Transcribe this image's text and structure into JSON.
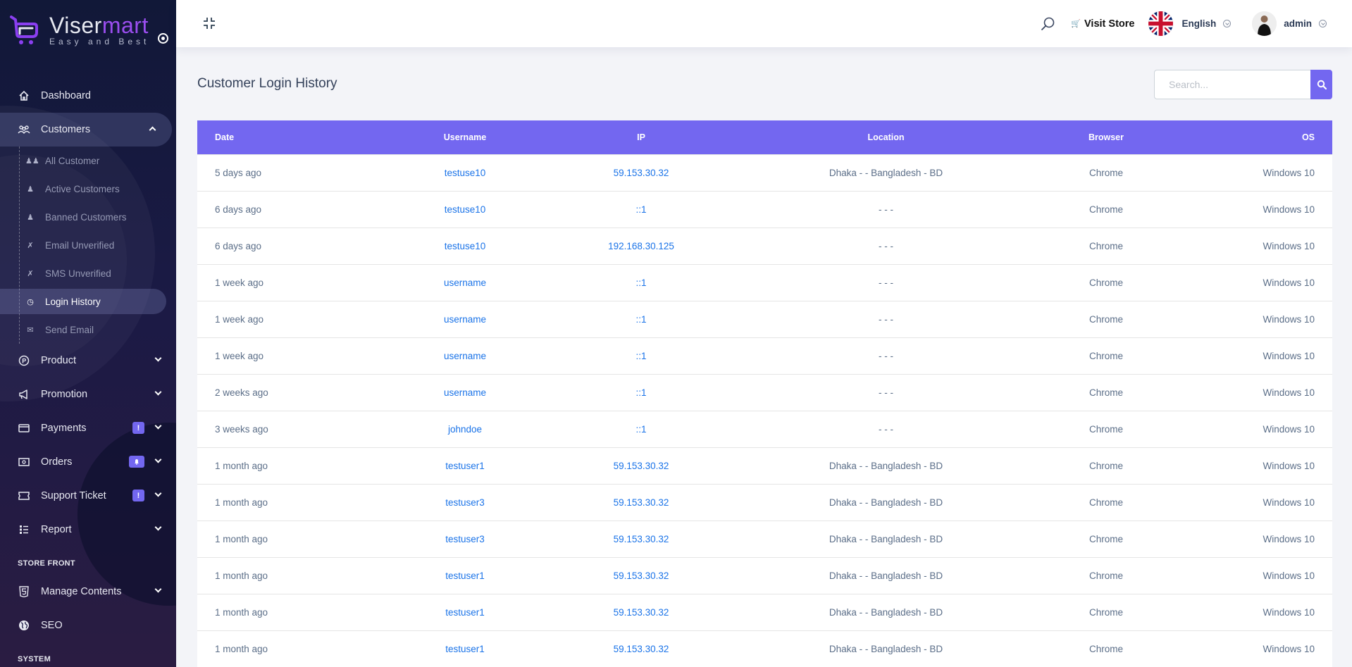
{
  "brand": {
    "name_part1": "Viser",
    "name_part2": "mart",
    "tagline": "Easy and Best"
  },
  "sidebar": {
    "items_top": [
      {
        "label": "Dashboard",
        "icon": "home-icon"
      }
    ],
    "customers": {
      "label": "Customers",
      "icon": "users-icon",
      "subitems": [
        {
          "label": "All Customer",
          "icon": "users-icon"
        },
        {
          "label": "Active Customers",
          "icon": "user-check-icon"
        },
        {
          "label": "Banned Customers",
          "icon": "user-ban-icon"
        },
        {
          "label": "Email Unverified",
          "icon": "user-slash-icon"
        },
        {
          "label": "SMS Unverified",
          "icon": "user-slash-icon"
        },
        {
          "label": "Login History",
          "icon": "history-icon",
          "active": true
        },
        {
          "label": "Send Email",
          "icon": "envelope-icon"
        }
      ]
    },
    "items_main": [
      {
        "label": "Product",
        "icon": "product-icon",
        "badge": ""
      },
      {
        "label": "Promotion",
        "icon": "megaphone-icon",
        "badge": "!"
      },
      {
        "label": "Payments",
        "icon": "credit-card-icon",
        "badge": "!"
      },
      {
        "label": "Orders",
        "icon": "money-icon",
        "badge": "bell"
      },
      {
        "label": "Support Ticket",
        "icon": "ticket-icon",
        "badge": "!"
      },
      {
        "label": "Report",
        "icon": "list-icon",
        "badge": ""
      }
    ],
    "section_store_front": "STORE FRONT",
    "items_store": [
      {
        "label": "Manage Contents",
        "icon": "html5-icon"
      },
      {
        "label": "SEO",
        "icon": "globe-icon"
      }
    ],
    "section_system": "SYSTEM"
  },
  "topbar": {
    "visit_store": "Visit Store",
    "language": "English",
    "user": "admin"
  },
  "page": {
    "title": "Customer Login History",
    "search_placeholder": "Search...",
    "accent": "#7367f0"
  },
  "table": {
    "headers": [
      "Date",
      "Username",
      "IP",
      "Location",
      "Browser",
      "OS"
    ],
    "rows": [
      [
        "5 days ago",
        "testuse10",
        "59.153.30.32",
        "Dhaka - - Bangladesh - BD",
        "Chrome",
        "Windows 10"
      ],
      [
        "6 days ago",
        "testuse10",
        "::1",
        "- - -",
        "Chrome",
        "Windows 10"
      ],
      [
        "6 days ago",
        "testuse10",
        "192.168.30.125",
        "- - -",
        "Chrome",
        "Windows 10"
      ],
      [
        "1 week ago",
        "username",
        "::1",
        "- - -",
        "Chrome",
        "Windows 10"
      ],
      [
        "1 week ago",
        "username",
        "::1",
        "- - -",
        "Chrome",
        "Windows 10"
      ],
      [
        "1 week ago",
        "username",
        "::1",
        "- - -",
        "Chrome",
        "Windows 10"
      ],
      [
        "2 weeks ago",
        "username",
        "::1",
        "- - -",
        "Chrome",
        "Windows 10"
      ],
      [
        "3 weeks ago",
        "johndoe",
        "::1",
        "- - -",
        "Chrome",
        "Windows 10"
      ],
      [
        "1 month ago",
        "testuser1",
        "59.153.30.32",
        "Dhaka - - Bangladesh - BD",
        "Chrome",
        "Windows 10"
      ],
      [
        "1 month ago",
        "testuser3",
        "59.153.30.32",
        "Dhaka - - Bangladesh - BD",
        "Chrome",
        "Windows 10"
      ],
      [
        "1 month ago",
        "testuser3",
        "59.153.30.32",
        "Dhaka - - Bangladesh - BD",
        "Chrome",
        "Windows 10"
      ],
      [
        "1 month ago",
        "testuser1",
        "59.153.30.32",
        "Dhaka - - Bangladesh - BD",
        "Chrome",
        "Windows 10"
      ],
      [
        "1 month ago",
        "testuser1",
        "59.153.30.32",
        "Dhaka - - Bangladesh - BD",
        "Chrome",
        "Windows 10"
      ],
      [
        "1 month ago",
        "testuser1",
        "59.153.30.32",
        "Dhaka - - Bangladesh - BD",
        "Chrome",
        "Windows 10"
      ]
    ]
  }
}
